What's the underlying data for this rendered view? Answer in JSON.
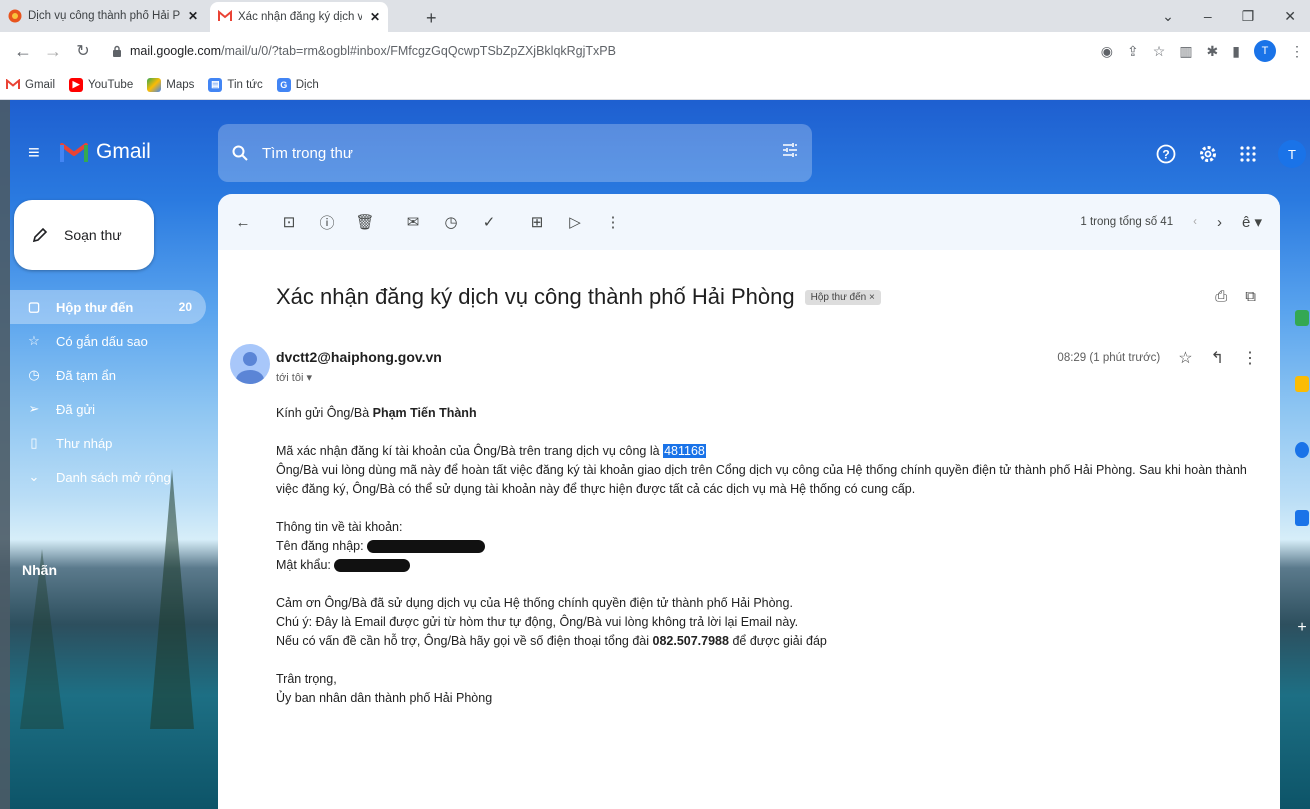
{
  "browser": {
    "tabs": [
      {
        "title": "Dịch vụ công thành phố Hải Phò",
        "active": false
      },
      {
        "title": "Xác nhận đăng ký dịch vụ công t",
        "active": true
      }
    ],
    "url_host": "mail.google.com",
    "url_path": "/mail/u/0/?tab=rm&ogbl#inbox/FMfcgzGqQcwpTSbZpZXjBklqkRgjTxPB",
    "profile_initial": "T",
    "bookmarks": [
      "Gmail",
      "YouTube",
      "Maps",
      "Tin tức",
      "Dịch"
    ]
  },
  "gmail": {
    "brand": "Gmail",
    "search_placeholder": "Tìm trong thư",
    "account_initial": "T",
    "compose_label": "Soạn thư",
    "nav": [
      {
        "label": "Hộp thư đến",
        "count": "20",
        "icon": "inbox-icon",
        "active": true
      },
      {
        "label": "Có gắn dấu sao",
        "count": "",
        "icon": "star-icon",
        "active": false
      },
      {
        "label": "Đã tạm ẩn",
        "count": "",
        "icon": "clock-icon",
        "active": false
      },
      {
        "label": "Đã gửi",
        "count": "",
        "icon": "send-icon",
        "active": false
      },
      {
        "label": "Thư nháp",
        "count": "",
        "icon": "draft-icon",
        "active": false
      },
      {
        "label": "Danh sách mở rộng",
        "count": "",
        "icon": "chevron-down-icon",
        "active": false
      }
    ],
    "labels_heading": "Nhãn",
    "pager_text": "1 trong tổng số 41"
  },
  "message": {
    "subject": "Xác nhận đăng ký dịch vụ công thành phố Hải Phòng",
    "folder_chip": "Hộp thư đến ×",
    "sender": "dvctt2@haiphong.gov.vn",
    "to_line": "tới tôi ▾",
    "time": "08:29 (1 phút trước)",
    "greeting_prefix": "Kính gửi Ông/Bà ",
    "greeting_name": "Phạm Tiến Thành",
    "code_prefix": "Mã xác nhận đăng kí tài khoản của Ông/Bà trên trang dịch vụ công là ",
    "code": "481168",
    "instructions": "Ông/Bà vui lòng dùng mã này để hoàn tất việc đăng ký tài khoản giao dịch trên Cổng dịch vụ công của Hệ thống chính quyền điện tử thành phố Hải Phòng. Sau khi hoàn thành việc đăng ký, Ông/Bà có thể sử dụng tài khoản này để thực hiện được tất cả các dịch vụ mà Hệ thống có cung cấp.",
    "account_info_heading": "Thông tin về tài khoản:",
    "username_label": "Tên đăng nhập: ",
    "password_label": "Mật khẩu: ",
    "thanks": "Cảm ơn Ông/Bà đã sử dụng dịch vụ của Hệ thống chính quyền điện tử thành phố Hải Phòng.",
    "note": "Chú ý: Đây là Email được gửi từ hòm thư tự động, Ông/Bà vui lòng không trả lời lại Email này.",
    "support_prefix": "Nếu có vấn đề cần hỗ trợ, Ông/Bà hãy gọi về số điện thoại tổng đài ",
    "support_phone": "082.507.7988",
    "support_suffix": " để được giải đáp",
    "closing": "Trân trọng,",
    "signature": "Ủy ban nhân dân thành phố Hải Phòng"
  },
  "colors": {
    "accent": "#1a73e8",
    "gmail_red": "#ea4335"
  }
}
